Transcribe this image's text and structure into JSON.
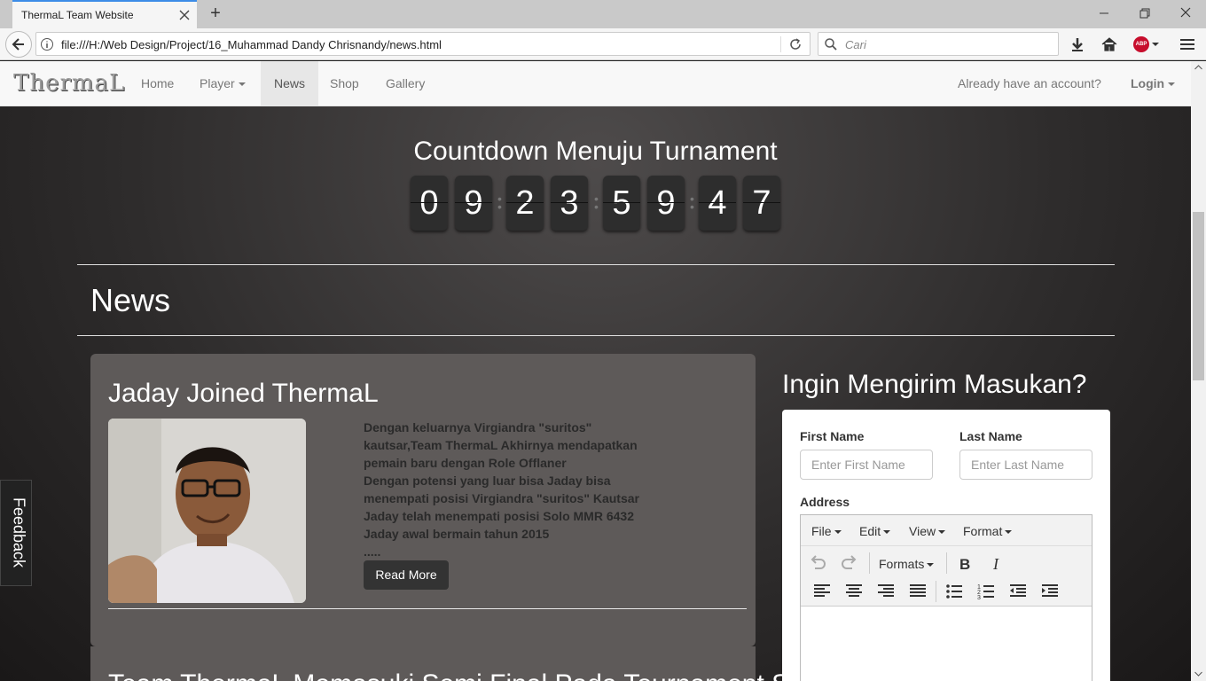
{
  "browser": {
    "tab_title": "ThermaL Team Website",
    "url": "file:///H:/Web Design/Project/16_Muhammad Dandy Chrisnandy/news.html",
    "search_placeholder": "Cari",
    "abp_label": "ABP"
  },
  "nav": {
    "brand": "ThermaL",
    "items": [
      {
        "label": "Home"
      },
      {
        "label": "Player"
      },
      {
        "label": "News"
      },
      {
        "label": "Shop"
      },
      {
        "label": "Gallery"
      }
    ],
    "account_prompt": "Already have an account?",
    "login": "Login"
  },
  "countdown": {
    "title": "Countdown Menuju Turnament",
    "digits": [
      "0",
      "9",
      "2",
      "3",
      "5",
      "9",
      "4",
      "7"
    ]
  },
  "news": {
    "heading": "News",
    "article1": {
      "title": "Jaday Joined ThermaL",
      "lines": [
        "Dengan keluarnya Virgiandra \"suritos\"",
        "kautsar,Team ThermaL Akhirnya mendapatkan",
        "pemain baru dengan Role Offlaner",
        "Dengan potensi yang luar bisa Jaday bisa",
        "menempati posisi Virgiandra \"suritos\" Kautsar",
        "Jaday telah menempati posisi Solo MMR 6432",
        "Jaday awal bermain tahun 2015",
        "....."
      ],
      "read_more": "Read More"
    },
    "article2": {
      "title": "Team ThermaL Memasuki Semi Final Pada Tournament SCDET"
    }
  },
  "form": {
    "title": "Ingin Mengirim Masukan?",
    "first_name_label": "First Name",
    "first_name_placeholder": "Enter First Name",
    "last_name_label": "Last Name",
    "last_name_placeholder": "Enter Last Name",
    "address_label": "Address",
    "editor_menus": [
      "File",
      "Edit",
      "View",
      "Format"
    ],
    "formats_label": "Formats"
  },
  "feedback": "Feedback"
}
